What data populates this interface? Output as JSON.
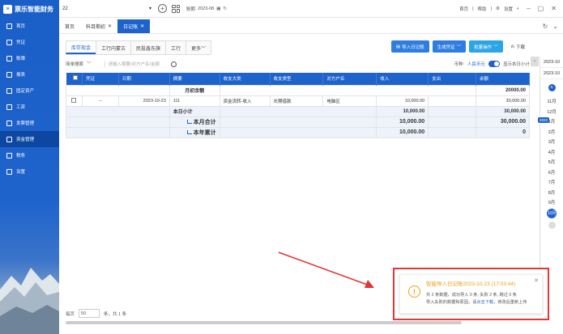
{
  "brand": {
    "logo_text": "票乐智能财务"
  },
  "sidebar": {
    "items": [
      {
        "label": "首页",
        "icon": "home-icon"
      },
      {
        "label": "凭证",
        "icon": "voucher-icon"
      },
      {
        "label": "账簿",
        "icon": "ledger-icon"
      },
      {
        "label": "报表",
        "icon": "report-icon"
      },
      {
        "label": "固定资产",
        "icon": "asset-icon"
      },
      {
        "label": "工资",
        "icon": "salary-icon"
      },
      {
        "label": "发票管理",
        "icon": "invoice-icon"
      },
      {
        "label": "资金管理",
        "icon": "fund-icon"
      },
      {
        "label": "税务",
        "icon": "tax-icon"
      },
      {
        "label": "设置",
        "icon": "settings-icon"
      }
    ]
  },
  "topbar": {
    "account": "22",
    "period_label": "账期",
    "period_value": "2023-08",
    "links": [
      "首页",
      "帮助",
      "设置"
    ]
  },
  "tabs": [
    {
      "label": "首页"
    },
    {
      "label": "科目期初"
    },
    {
      "label": "日记账"
    }
  ],
  "subtabs": [
    "库存现金",
    "工行内蒙古",
    "民投鑫东旗",
    "工行",
    "更多"
  ],
  "buttons": {
    "import": "导入日记账",
    "generate": "生成凭证",
    "batch": "批量操作",
    "download": "下载"
  },
  "filter": {
    "mode": "简单搜索",
    "placeholder": "请输入摘要/对方户名/金额",
    "currency_label": "币种:",
    "currency_value": "人民币元",
    "daily_subtotal": "显示本日小计"
  },
  "table": {
    "headers": [
      "凭证",
      "日期",
      "摘要",
      "收支大类",
      "收支类型",
      "对方户名",
      "收入",
      "支出",
      "余额"
    ],
    "opening_label": "月初余额",
    "opening_balance": "20000.00",
    "rows": [
      {
        "voucher": "--",
        "date": "2023-10-23",
        "summary": "111",
        "category": "资金流转-收入",
        "type": "长期借款",
        "counterparty": "电脑区",
        "income": "10,000.00",
        "expense": "",
        "balance": "30,000.00"
      }
    ],
    "day_total": {
      "label": "本日小计",
      "income": "10,000.00",
      "expense": "",
      "balance": "30,000.00"
    },
    "month_total": {
      "label": "本月合计",
      "income": "10,000.00",
      "expense": "",
      "balance": "30,000.00"
    },
    "year_total": {
      "label": "本年累计",
      "income": "10,000.00",
      "expense": "",
      "balance": "0"
    }
  },
  "pager": {
    "prefix": "每页",
    "size": "50",
    "suffix": "条，共 1 条"
  },
  "date_panel": {
    "top_label": "2023-10",
    "months": [
      "11月",
      "12月",
      "1月",
      "2月",
      "3月",
      "4月",
      "5月",
      "6月",
      "7月",
      "8月",
      "9月",
      "10月"
    ],
    "current": "10月",
    "side_label": "2023-10",
    "tag": "2022"
  },
  "toast": {
    "title": "智能导入日记账2023-10-23 (17:03:44)",
    "line1": "共 2 条数据，成功导入 0 条, 失败 2 条, 跳过 0 条",
    "line2_prefix": "导入失败的数据和原因，请",
    "line2_link": "点击下载",
    "line2_suffix": "，修改后重新上传"
  },
  "colors": {
    "primary": "#1e63cc",
    "warn": "#f39c12",
    "highlight_border": "#e33333"
  }
}
